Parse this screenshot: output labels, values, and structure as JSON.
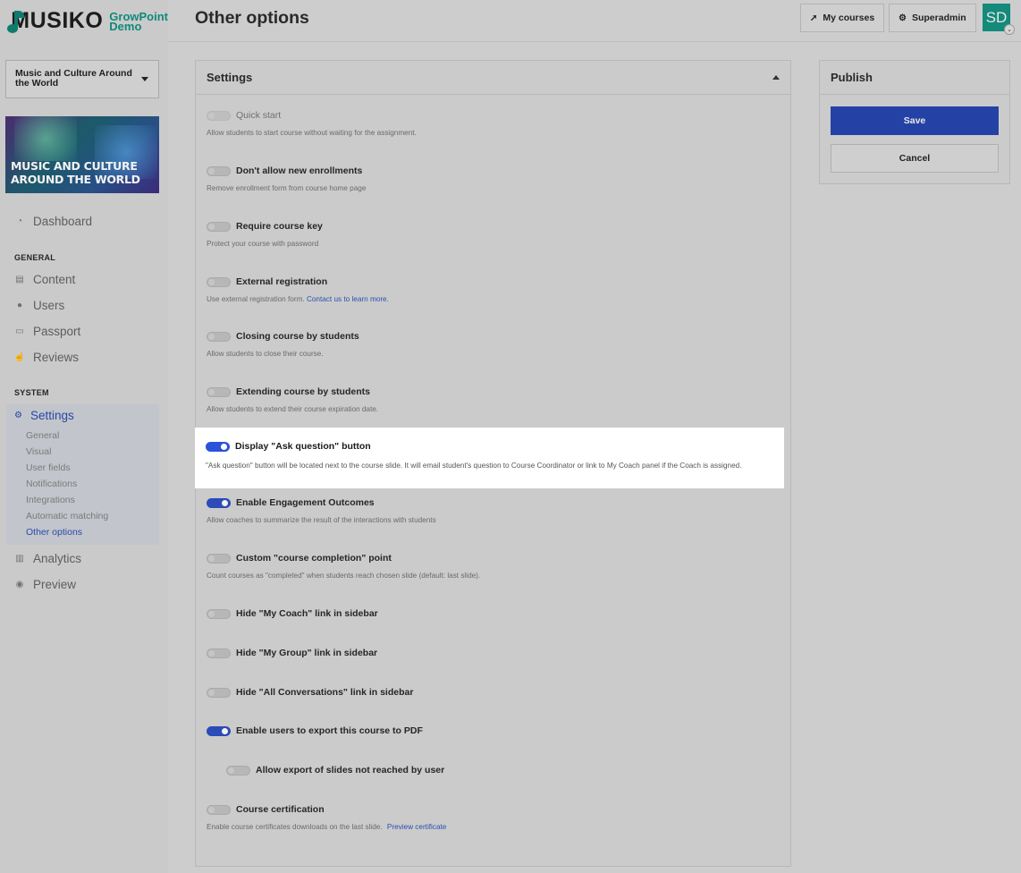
{
  "brand": {
    "name": "MUSIKO",
    "sub_line1": "GrowPoint",
    "sub_line2": "Demo"
  },
  "course": {
    "selected": "Music and Culture Around the World",
    "image_caption_line1": "MUSIC AND CULTURE",
    "image_caption_line2": "AROUND THE WORLD"
  },
  "sidebar": {
    "dashboard": "Dashboard",
    "general_section": "GENERAL",
    "content": "Content",
    "users": "Users",
    "passport": "Passport",
    "reviews": "Reviews",
    "system_section": "SYSTEM",
    "settings": "Settings",
    "settings_sub": [
      "General",
      "Visual",
      "User fields",
      "Notifications",
      "Integrations",
      "Automatic matching",
      "Other options"
    ],
    "analytics": "Analytics",
    "preview": "Preview"
  },
  "header": {
    "title": "Other options",
    "my_courses": "My courses",
    "superadmin": "Superadmin",
    "avatar_initials": "SD"
  },
  "settings_panel": {
    "title": "Settings",
    "options": [
      {
        "label": "Quick start",
        "desc": "Allow students to start course without waiting for the assignment.",
        "on": false
      },
      {
        "label": "Don't allow new enrollments",
        "desc": "Remove enrollment form from course home page",
        "on": false
      },
      {
        "label": "Require course key",
        "desc": "Protect your course with password",
        "on": false
      },
      {
        "label": "External registration",
        "desc": "Use external registration form.",
        "link": "Contact us to learn more.",
        "on": false
      },
      {
        "label": "Closing course by students",
        "desc": "Allow students to close their course.",
        "on": false
      },
      {
        "label": "Extending course by students",
        "desc": "Allow students to extend their course expiration date.",
        "on": false
      },
      {
        "label": "Display \"Ask question\" button",
        "desc": "\"Ask question\" button will be located next to the course slide. It will email student's question to Course Coordinator or link to My Coach panel if the Coach is assigned.",
        "on": true
      },
      {
        "label": "Enable Engagement Outcomes",
        "desc": "Allow coaches to summarize the result of the interactions with students",
        "on": true
      },
      {
        "label": "Custom \"course completion\" point",
        "desc": "Count courses as \"completed\" when students reach chosen slide (default: last slide).",
        "on": false
      },
      {
        "label": "Hide \"My Coach\" link in sidebar",
        "on": false
      },
      {
        "label": "Hide \"My Group\" link in sidebar",
        "on": false
      },
      {
        "label": "Hide \"All Conversations\" link in sidebar",
        "on": false
      },
      {
        "label": "Enable users to export this course to PDF",
        "on": true
      },
      {
        "label": "Allow export of slides not reached by user",
        "on": false
      },
      {
        "label": "Course certification",
        "desc": "Enable course certificates downloads on the last slide.",
        "link": "Preview certificate",
        "on": false
      }
    ]
  },
  "publish": {
    "title": "Publish",
    "save": "Save",
    "cancel": "Cancel"
  },
  "colors": {
    "accent": "#2b52d8",
    "brand": "#138a7a"
  }
}
